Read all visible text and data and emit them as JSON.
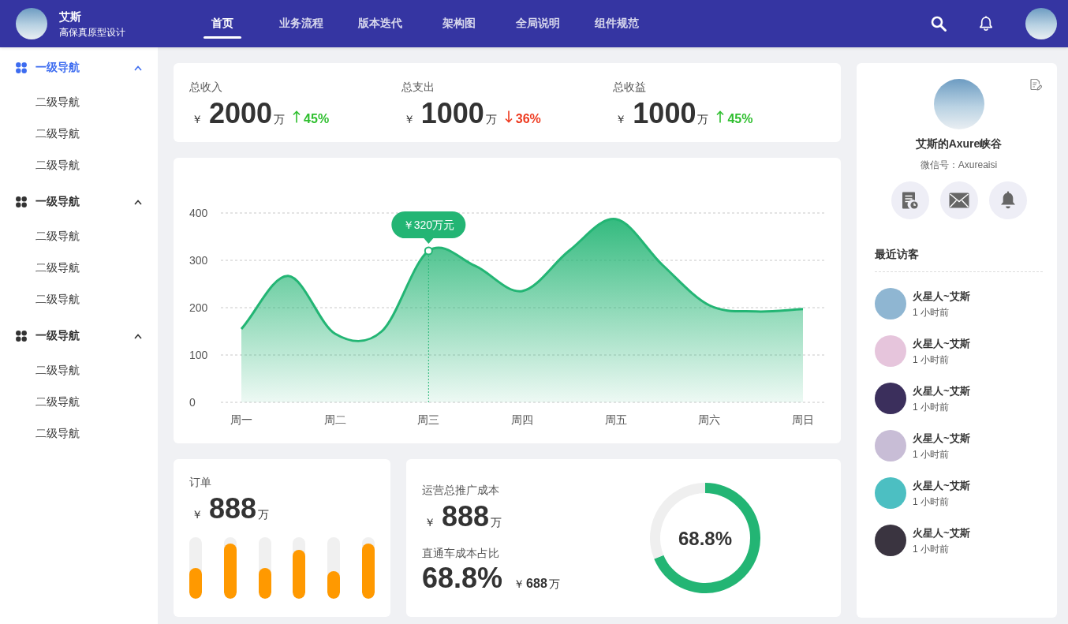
{
  "header": {
    "brand": {
      "name": "艾斯",
      "subtitle": "高保真原型设计"
    },
    "tabs": [
      {
        "label": "首页",
        "selected": true
      },
      {
        "label": "业务流程",
        "selected": false
      },
      {
        "label": "版本迭代",
        "selected": false
      },
      {
        "label": "架构图",
        "selected": false
      },
      {
        "label": "全局说明",
        "selected": false
      },
      {
        "label": "组件规范",
        "selected": false
      }
    ]
  },
  "sidebar": {
    "groups": [
      {
        "label": "一级导航",
        "selected": true,
        "expanded": true,
        "children": [
          {
            "label": "二级导航",
            "selected": false
          },
          {
            "label": "二级导航",
            "selected": false
          },
          {
            "label": "二级导航",
            "selected": false
          }
        ]
      },
      {
        "label": "一级导航",
        "selected": false,
        "expanded": true,
        "children": [
          {
            "label": "二级导航",
            "selected": false
          },
          {
            "label": "二级导航",
            "selected": false
          },
          {
            "label": "二级导航",
            "selected": false
          }
        ]
      },
      {
        "label": "一级导航",
        "selected": false,
        "expanded": true,
        "children": [
          {
            "label": "二级导航",
            "selected": false
          },
          {
            "label": "二级导航",
            "selected": false
          },
          {
            "label": "二级导航",
            "selected": false
          }
        ]
      }
    ]
  },
  "stats": [
    {
      "label": "总收入",
      "currency": "￥",
      "value": "2000",
      "unit": "万",
      "kind": "up",
      "change": "45%"
    },
    {
      "label": "总支出",
      "currency": "￥",
      "value": "1000",
      "unit": "万",
      "kind": "down",
      "change": "36%"
    },
    {
      "label": "总收益",
      "currency": "￥",
      "value": "1000",
      "unit": "万",
      "kind": "up",
      "change": "45%"
    }
  ],
  "chart": {
    "chart_data": {
      "type": "area",
      "categories": [
        "周一",
        null,
        "周二",
        null,
        "周三",
        null,
        "周四",
        null,
        "周五",
        null,
        "周六",
        null,
        "周日"
      ],
      "values": [
        155,
        267,
        145,
        150,
        320,
        288,
        235,
        320,
        387,
        290,
        205,
        192,
        197
      ],
      "ylim": [
        0,
        400
      ],
      "yticks": [
        0,
        100,
        200,
        300,
        400
      ],
      "grid": true,
      "ref_lines": [
        {
          "axis": "x",
          "value": "周三"
        }
      ],
      "annotations": [
        {
          "x": "周三",
          "y": 320,
          "text": "￥320万元"
        }
      ]
    }
  },
  "orders": {
    "label": "订单",
    "currency": "￥",
    "value": "888",
    "unit": "万",
    "bars": [
      {
        "level": 0.5
      },
      {
        "level": 0.9
      },
      {
        "level": 0.5
      },
      {
        "level": 0.8
      },
      {
        "level": 0.45
      },
      {
        "level": 0.9
      }
    ]
  },
  "cost": {
    "label": "运营总推广成本",
    "currency": "￥",
    "value": "888",
    "unit": "万",
    "ratio_label": "直通车成本占比",
    "ratio": "68.8%",
    "sub_currency": "￥",
    "sub_value": "688",
    "sub_unit": "万",
    "donut": {
      "center_label": "68.8%",
      "chart_data": {
        "type": "donut",
        "values": [
          68.8,
          31.2
        ]
      }
    }
  },
  "profile": {
    "name": "艾斯的Axure峡谷",
    "wechat": "微信号：Axureaisi",
    "visitors_title": "最近访客",
    "visitors": [
      {
        "name": "火星人~艾斯",
        "time": "1 小时前",
        "color": "#8fb6d2"
      },
      {
        "name": "火星人~艾斯",
        "time": "1 小时前",
        "color": "#e6c5dc"
      },
      {
        "name": "火星人~艾斯",
        "time": "1 小时前",
        "color": "#3b2f5c"
      },
      {
        "name": "火星人~艾斯",
        "time": "1 小时前",
        "color": "#c8bdd6"
      },
      {
        "name": "火星人~艾斯",
        "time": "1 小时前",
        "color": "#4cbfc2"
      },
      {
        "name": "火星人~艾斯",
        "time": "1 小时前",
        "color": "#3a3440"
      }
    ]
  }
}
